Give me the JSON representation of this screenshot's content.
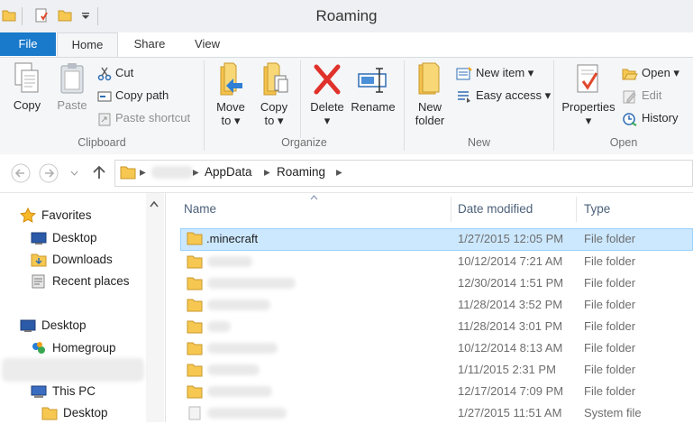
{
  "window": {
    "title": "Roaming"
  },
  "ribbon_tabs": {
    "file": "File",
    "home": "Home",
    "share": "Share",
    "view": "View"
  },
  "clipboard": {
    "copy": "Copy",
    "paste": "Paste",
    "cut": "Cut",
    "copy_path": "Copy path",
    "paste_shortcut": "Paste shortcut",
    "label": "Clipboard"
  },
  "organize": {
    "move_to": "Move",
    "move_to2": "to",
    "copy_to": "Copy",
    "copy_to2": "to",
    "delete": "Delete",
    "rename": "Rename",
    "label": "Organize"
  },
  "new": {
    "new_folder": "New",
    "new_folder2": "folder",
    "new_item": "New item",
    "easy_access": "Easy access",
    "label": "New"
  },
  "open": {
    "properties": "Properties",
    "open": "Open",
    "edit": "Edit",
    "history": "History",
    "label": "Open"
  },
  "address": {
    "crumbs": [
      "AppData",
      "Roaming"
    ]
  },
  "nav": {
    "items": [
      {
        "label": "Favorites"
      },
      {
        "label": "Desktop"
      },
      {
        "label": "Downloads"
      },
      {
        "label": "Recent places"
      },
      {
        "label": "Desktop"
      },
      {
        "label": "Homegroup"
      },
      {
        "label": "This PC"
      },
      {
        "label": "Desktop"
      }
    ]
  },
  "columns": {
    "name": "Name",
    "date": "Date modified",
    "type": "Type"
  },
  "files": [
    {
      "name": ".minecraft",
      "date": "1/27/2015 12:05 PM",
      "type": "File folder"
    },
    {
      "name": "",
      "date": "10/12/2014 7:21 AM",
      "type": "File folder"
    },
    {
      "name": "",
      "date": "12/30/2014 1:51 PM",
      "type": "File folder"
    },
    {
      "name": "",
      "date": "11/28/2014 3:52 PM",
      "type": "File folder"
    },
    {
      "name": "",
      "date": "11/28/2014 3:01 PM",
      "type": "File folder"
    },
    {
      "name": "",
      "date": "10/12/2014 8:13 AM",
      "type": "File folder"
    },
    {
      "name": "",
      "date": "1/11/2015 2:31 PM",
      "type": "File folder"
    },
    {
      "name": "",
      "date": "12/17/2014 7:09 PM",
      "type": "File folder"
    },
    {
      "name": "",
      "date": "1/27/2015 11:51 AM",
      "type": "System file"
    }
  ]
}
